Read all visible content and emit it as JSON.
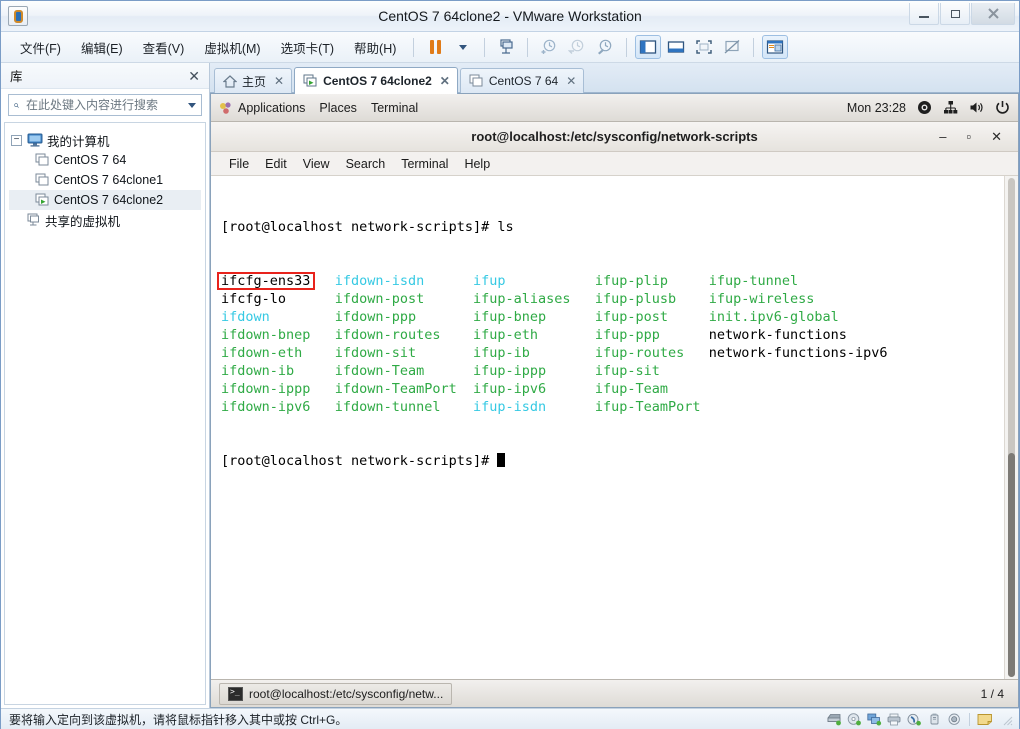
{
  "window": {
    "title": "CentOS 7 64clone2 - VMware Workstation",
    "app_icon": "vmware-icon",
    "minimize_label": "–",
    "maximize_label": "□",
    "close_label": "✕"
  },
  "menubar": {
    "items": [
      {
        "label": "文件(F)",
        "name": "menu-file"
      },
      {
        "label": "编辑(E)",
        "name": "menu-edit"
      },
      {
        "label": "查看(V)",
        "name": "menu-view"
      },
      {
        "label": "虚拟机(M)",
        "name": "menu-vm"
      },
      {
        "label": "选项卡(T)",
        "name": "menu-tabs"
      },
      {
        "label": "帮助(H)",
        "name": "menu-help"
      }
    ],
    "toolbar": [
      {
        "name": "pause-button",
        "icon": "pause-icon"
      },
      {
        "name": "power-dropdown",
        "icon": "chevron-down-icon"
      },
      {
        "name": "manage-snapshots-button",
        "icon": "snapshot-manager-icon"
      },
      {
        "name": "take-snapshot-button",
        "icon": "snapshot-add-icon"
      },
      {
        "name": "revert-snapshot-button",
        "icon": "snapshot-revert-icon"
      },
      {
        "name": "snapshot-manager-button",
        "icon": "snapshot-settings-icon"
      },
      {
        "name": "show-library-button",
        "icon": "library-panel-icon"
      },
      {
        "name": "show-thumbnail-bar-button",
        "icon": "thumbnail-bar-icon"
      },
      {
        "name": "fullscreen-button",
        "icon": "fullscreen-icon"
      },
      {
        "name": "unity-button",
        "icon": "unity-icon"
      },
      {
        "name": "console-view-button",
        "icon": "console-view-icon"
      }
    ]
  },
  "sidebar": {
    "title": "库",
    "close_label": "✕",
    "search": {
      "placeholder": "在此处键入内容进行搜索",
      "value": "",
      "icon": "search-icon",
      "dropdown_icon": "chevron-down-icon"
    },
    "tree": {
      "root": {
        "label": "我的计算机",
        "icon": "computer-icon",
        "expander": "−"
      },
      "vms": [
        {
          "label": "CentOS 7 64",
          "icon": "vm-icon",
          "running": false
        },
        {
          "label": "CentOS 7 64clone1",
          "icon": "vm-icon",
          "running": false
        },
        {
          "label": "CentOS 7 64clone2",
          "icon": "vm-running-icon",
          "running": true
        }
      ],
      "shared": {
        "label": "共享的虚拟机",
        "icon": "shared-vm-icon"
      }
    }
  },
  "tabs": [
    {
      "label": "主页",
      "icon": "home-icon",
      "active": false,
      "close_label": "✕"
    },
    {
      "label": "CentOS 7 64clone2",
      "icon": "vm-running-icon",
      "active": true,
      "close_label": "✕"
    },
    {
      "label": "CentOS 7 64",
      "icon": "vm-icon",
      "active": false,
      "close_label": "✕"
    }
  ],
  "guest": {
    "panel": {
      "applications": "Applications",
      "places": "Places",
      "terminal": "Terminal",
      "clock": "Mon 23:28",
      "tray": [
        {
          "name": "accessibility-icon"
        },
        {
          "name": "network-icon"
        },
        {
          "name": "volume-icon"
        },
        {
          "name": "power-icon"
        }
      ]
    },
    "terminal": {
      "title": "root@localhost:/etc/sysconfig/network-scripts",
      "minimize_label": "–",
      "maximize_label": "▫",
      "close_label": "✕",
      "menus": [
        "File",
        "Edit",
        "View",
        "Search",
        "Terminal",
        "Help"
      ],
      "prompt": "[root@localhost network-scripts]# ",
      "command": "ls",
      "highlight_target": "ifcfg-ens33",
      "columns": [
        [
          {
            "text": "ifcfg-ens33",
            "color": "white"
          },
          {
            "text": "ifcfg-lo",
            "color": "white"
          },
          {
            "text": "ifdown",
            "color": "cyan"
          },
          {
            "text": "ifdown-bnep",
            "color": "green"
          },
          {
            "text": "ifdown-eth",
            "color": "green"
          },
          {
            "text": "ifdown-ib",
            "color": "green"
          },
          {
            "text": "ifdown-ippp",
            "color": "green"
          },
          {
            "text": "ifdown-ipv6",
            "color": "green"
          }
        ],
        [
          {
            "text": "ifdown-isdn",
            "color": "cyan"
          },
          {
            "text": "ifdown-post",
            "color": "green"
          },
          {
            "text": "ifdown-ppp",
            "color": "green"
          },
          {
            "text": "ifdown-routes",
            "color": "green"
          },
          {
            "text": "ifdown-sit",
            "color": "green"
          },
          {
            "text": "ifdown-Team",
            "color": "green"
          },
          {
            "text": "ifdown-TeamPort",
            "color": "green"
          },
          {
            "text": "ifdown-tunnel",
            "color": "green"
          }
        ],
        [
          {
            "text": "ifup",
            "color": "cyan"
          },
          {
            "text": "ifup-aliases",
            "color": "green"
          },
          {
            "text": "ifup-bnep",
            "color": "green"
          },
          {
            "text": "ifup-eth",
            "color": "green"
          },
          {
            "text": "ifup-ib",
            "color": "green"
          },
          {
            "text": "ifup-ippp",
            "color": "green"
          },
          {
            "text": "ifup-ipv6",
            "color": "green"
          },
          {
            "text": "ifup-isdn",
            "color": "cyan"
          }
        ],
        [
          {
            "text": "ifup-plip",
            "color": "green"
          },
          {
            "text": "ifup-plusb",
            "color": "green"
          },
          {
            "text": "ifup-post",
            "color": "green"
          },
          {
            "text": "ifup-ppp",
            "color": "green"
          },
          {
            "text": "ifup-routes",
            "color": "green"
          },
          {
            "text": "ifup-sit",
            "color": "green"
          },
          {
            "text": "ifup-Team",
            "color": "green"
          },
          {
            "text": "ifup-TeamPort",
            "color": "green"
          }
        ],
        [
          {
            "text": "ifup-tunnel",
            "color": "green"
          },
          {
            "text": "ifup-wireless",
            "color": "green"
          },
          {
            "text": "init.ipv6-global",
            "color": "green"
          },
          {
            "text": "network-functions",
            "color": "white"
          },
          {
            "text": "network-functions-ipv6",
            "color": "white"
          },
          {
            "text": "",
            "color": "white"
          },
          {
            "text": "",
            "color": "white"
          },
          {
            "text": "",
            "color": "white"
          }
        ]
      ],
      "colors": {
        "white": "#000000",
        "green": "#2faa45",
        "cyan": "#35c9e3",
        "background": "#ffffff",
        "highlight_box": "#e8231c"
      }
    },
    "taskbar": {
      "task_label": "root@localhost:/etc/sysconfig/netw...",
      "task_icon": "terminal-icon",
      "workspace": "1 / 4"
    }
  },
  "statusbar": {
    "message": "要将输入定向到该虚拟机，请将鼠标指针移入其中或按 Ctrl+G。",
    "devices": [
      {
        "name": "hard-disk-icon"
      },
      {
        "name": "cd-dvd-icon"
      },
      {
        "name": "network-adapter-icon"
      },
      {
        "name": "printer-icon"
      },
      {
        "name": "sound-card-icon"
      },
      {
        "name": "usb-icon"
      },
      {
        "name": "camera-icon"
      },
      {
        "name": "message-note-icon"
      }
    ]
  }
}
